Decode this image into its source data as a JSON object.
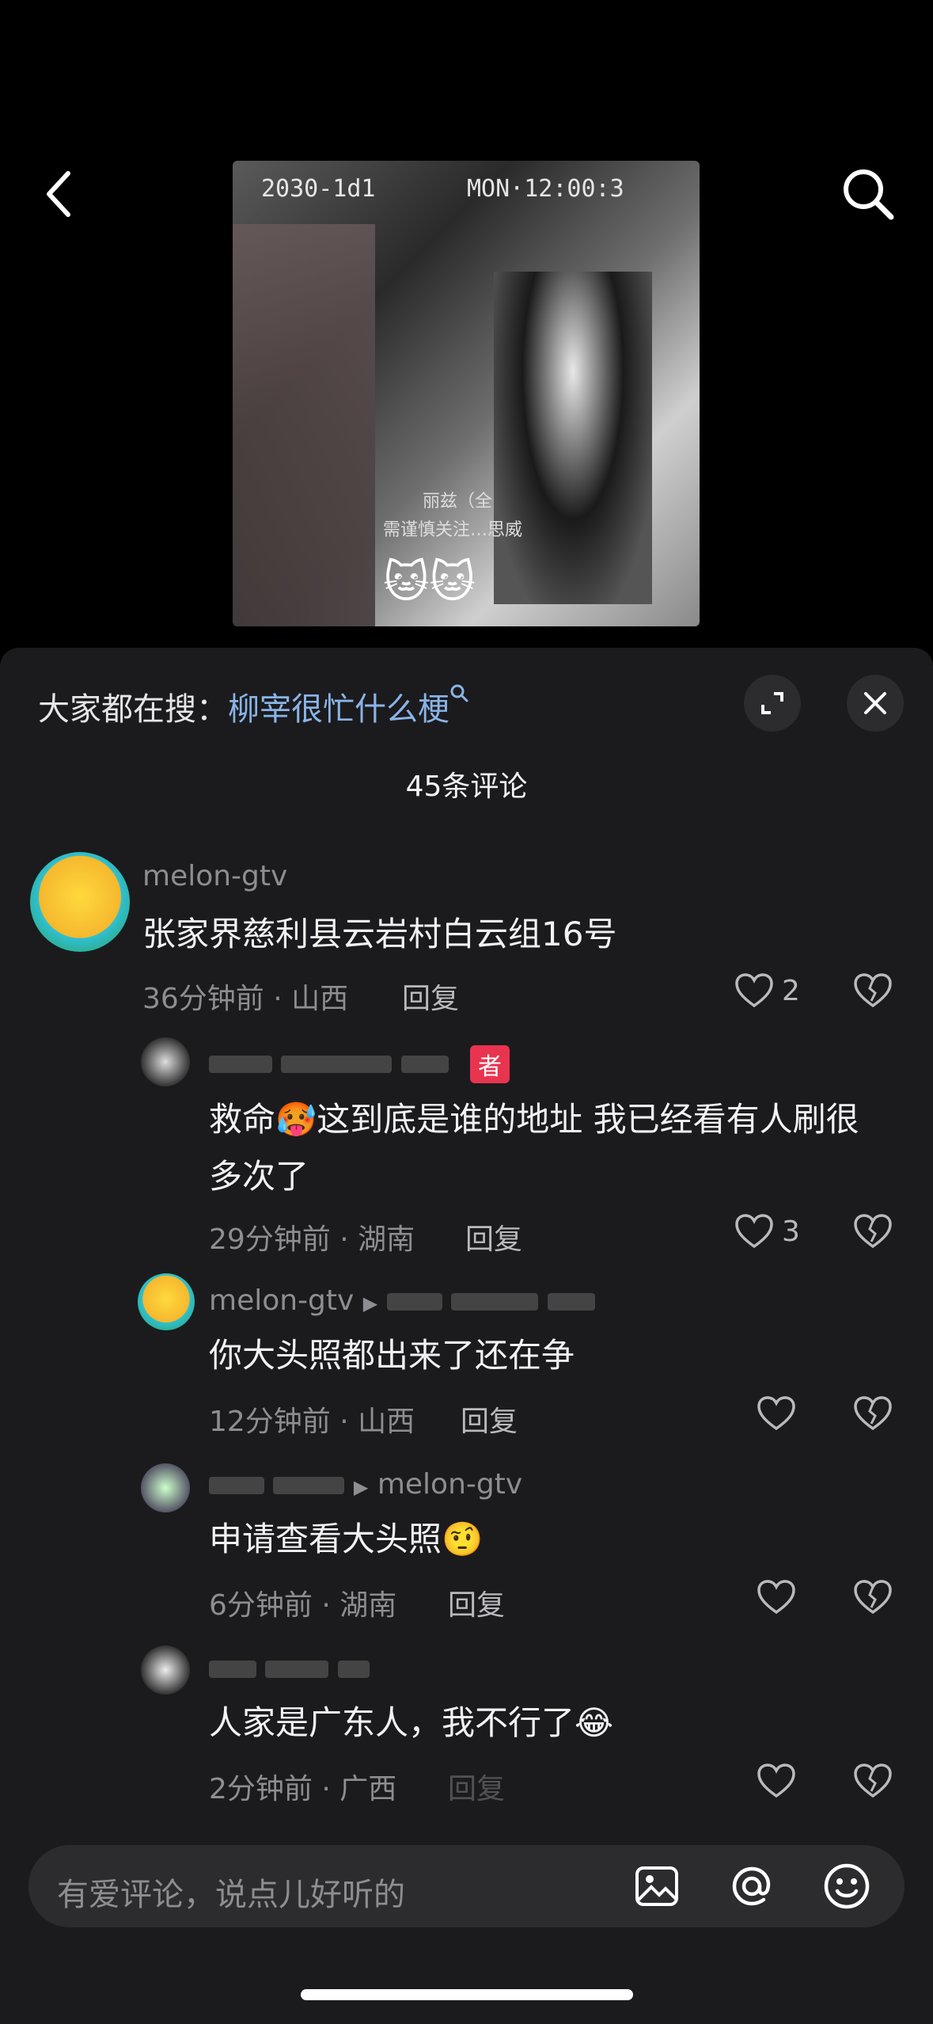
{
  "video": {
    "timestamp_date": "2030-1d1",
    "timestamp_time": "MON·12:00:3",
    "caption_line1": "丽兹（全",
    "caption_line2": "需谨慎关注…思威",
    "stickers": "🐱🐱"
  },
  "hot_search": {
    "prefix": "大家都在搜：",
    "term": "柳宰很忙什么梗"
  },
  "comments_count": "45条评论",
  "comments": [
    {
      "name": "melon-gtv",
      "text": "张家界慈利县云岩村白云组16号",
      "meta": "36分钟前 · 山西",
      "reply": "回复",
      "likes": "2"
    },
    {
      "name_tag": "者",
      "text": "救命🥵这到底是谁的地址 我已经看有人刷很多次了",
      "meta": "29分钟前 · 湖南",
      "reply": "回复",
      "likes": "3"
    },
    {
      "name": "melon-gtv",
      "text": "你大头照都出来了还在争",
      "meta": "12分钟前 · 山西",
      "reply": "回复",
      "likes": ""
    },
    {
      "reply_to": "melon-gtv",
      "text": "申请查看大头照🤨",
      "meta": "6分钟前 · 湖南",
      "reply": "回复",
      "likes": ""
    },
    {
      "text": "人家是广东人，我不行了😂",
      "meta": "2分钟前 · 广西",
      "reply": "回复",
      "likes": ""
    }
  ],
  "input": {
    "placeholder": "有爱评论，说点儿好听的"
  }
}
